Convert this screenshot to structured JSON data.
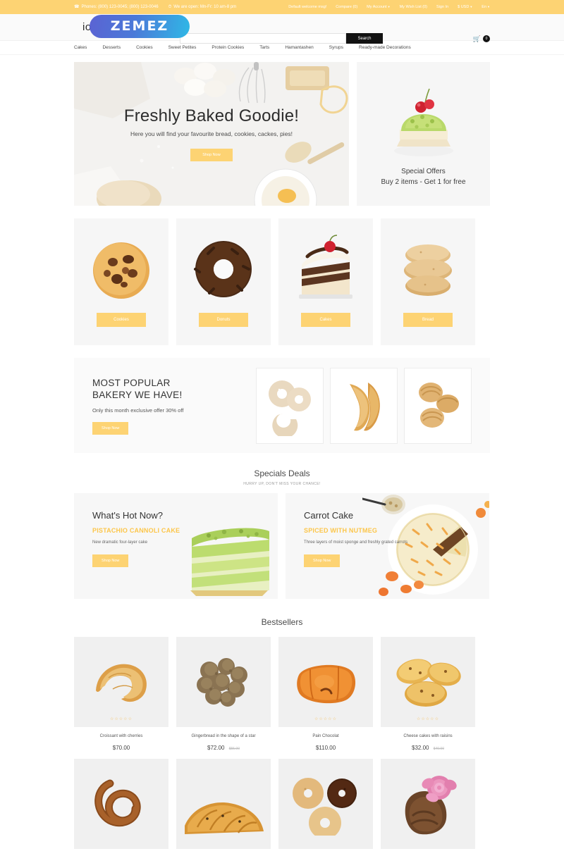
{
  "topbar": {
    "phone_icon": "phone-icon",
    "phone": "Phones: (800) 123-0045; (800) 123-0046",
    "clock_icon": "clock-icon",
    "hours": "We are open: Mn-Fr: 10 am-8 pm",
    "links": [
      {
        "label": "Default welcome msg!"
      },
      {
        "label": "Compare (0)"
      },
      {
        "label": "My Account"
      },
      {
        "label": "My Wish List (0)"
      },
      {
        "label": "Sign In"
      },
      {
        "label": "$ USD"
      },
      {
        "label": "En"
      }
    ],
    "bg_color": "#fdd373"
  },
  "header": {
    "brand": "io",
    "watermark_logo": "ZEMEZ",
    "search_placeholder": "",
    "search_value": "",
    "search_button": "Search",
    "cart_icon": "shopping-cart-icon",
    "cart_count": "0"
  },
  "nav": {
    "items": [
      "Cakes",
      "Desserts",
      "Cookies",
      "Sweet Petites",
      "Protein Cookies",
      "Tarts",
      "Hamantashen",
      "Syrups",
      "Ready-made Decorations"
    ]
  },
  "hero": {
    "title": "Freshly Baked Goodie!",
    "subtitle": "Here you will find your favourite bread, cookies, cackes, pies!",
    "button": "Shop Now"
  },
  "offer": {
    "title": "Special Offers",
    "subtitle": "Buy 2 items - Get 1 for free",
    "image": "pistachio-cake-with-cherry"
  },
  "categories": [
    {
      "label": "Cookies",
      "image": "chocolate-chip-cookie"
    },
    {
      "label": "Donuts",
      "image": "chocolate-donut"
    },
    {
      "label": "Cakes",
      "image": "layer-cake-slice-with-cherry"
    },
    {
      "label": "Bread",
      "image": "stacked-bread-rolls"
    }
  ],
  "popular": {
    "line1": "MOST POPULAR",
    "line2": "BAKERY WE HAVE!",
    "subtitle": "Only this month exclusive offer 30% off",
    "button": "Shop Now",
    "images": [
      "powdered-donuts",
      "croissants",
      "cream-puffs"
    ]
  },
  "specials": {
    "title": "Specials Deals",
    "subtitle": "HURRY UP, DON'T MISS YOUR CHANCE!"
  },
  "deals": [
    {
      "title": "What's Hot Now?",
      "subtitle": "PISTACHIO CANNOLI CAKE",
      "description": "New dramatic four-layer cake",
      "button": "Shop Now",
      "image": "pistachio-layer-cake"
    },
    {
      "title": "Carrot Cake",
      "subtitle": "SPICED WITH NUTMEG",
      "description": "Three layers of moist sponge and freshly grated carrots",
      "button": "Shop Now",
      "image": "carrot-cake-on-plate"
    }
  ],
  "bestsellers": {
    "title": "Bestsellers",
    "products": [
      {
        "name": "Croissant with cherries",
        "price": "$70.00",
        "old_price": "",
        "rating": 0,
        "image": "croissant"
      },
      {
        "name": "Gingerbread in the shape of a star",
        "price": "$72.00",
        "old_price": "$55.00",
        "rating": 0,
        "image": "gingerbread-stars"
      },
      {
        "name": "Pain Chocolat",
        "price": "$110.00",
        "old_price": "",
        "rating": 0,
        "image": "pain-au-chocolat"
      },
      {
        "name": "Cheese cakes with raisins",
        "price": "$32.00",
        "old_price": "$40.00",
        "rating": 0,
        "image": "cheese-cakes-with-raisins"
      },
      {
        "name": "",
        "price": "",
        "old_price": "",
        "rating": 0,
        "image": "pretzel"
      },
      {
        "name": "",
        "price": "",
        "old_price": "",
        "rating": 0,
        "image": "braided-bread"
      },
      {
        "name": "",
        "price": "",
        "old_price": "",
        "rating": 0,
        "image": "assorted-donuts"
      },
      {
        "name": "",
        "price": "",
        "old_price": "",
        "rating": 0,
        "image": "chocolate-cupcake-with-rose"
      }
    ]
  },
  "colors": {
    "accent": "#fdd373",
    "accent_text": "#fcc64a",
    "dark": "#121212",
    "panel": "#f6f6f6"
  }
}
